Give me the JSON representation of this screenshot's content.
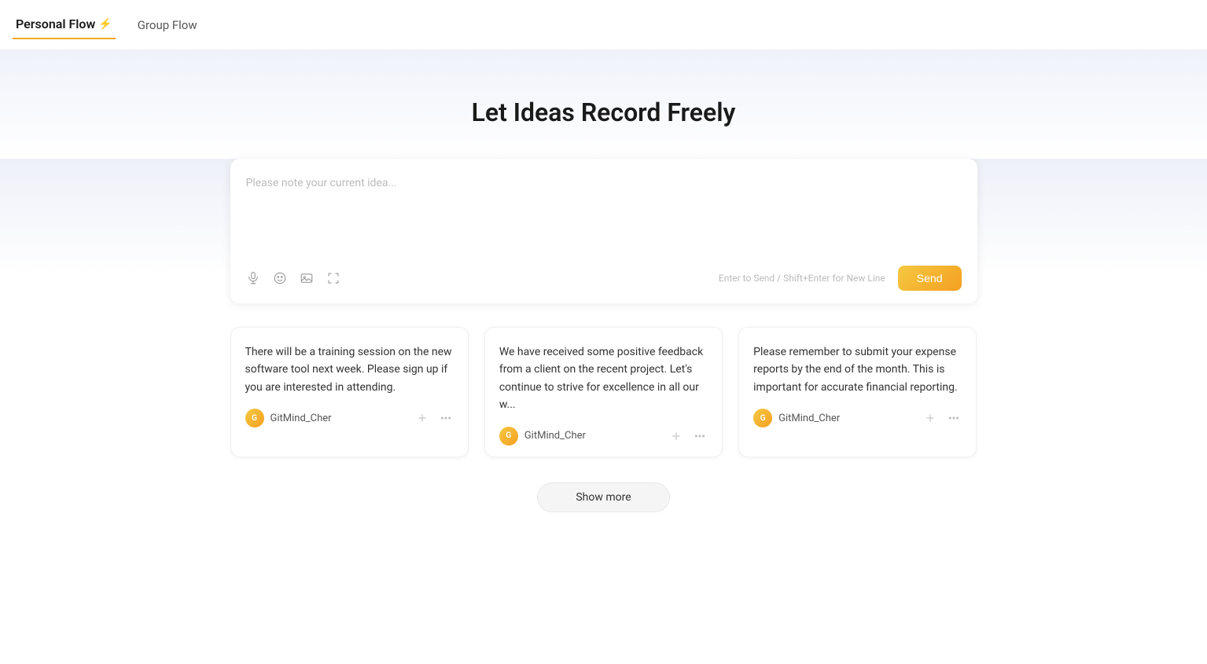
{
  "nav": {
    "personal_flow_label": "Personal Flow",
    "personal_flow_icon": "⚡",
    "group_flow_label": "Group Flow"
  },
  "hero": {
    "title": "Let Ideas Record Freely"
  },
  "input": {
    "placeholder": "Please note your current idea...",
    "hint": "Enter to Send / Shift+Enter for New Line",
    "send_label": "Send",
    "icons": {
      "mic": "mic-icon",
      "emoji": "emoji-icon",
      "image": "image-icon",
      "expand": "expand-icon"
    }
  },
  "cards": [
    {
      "id": 1,
      "text": "There will be a training session on the new software tool next week. Please sign up if you are interested in attending.",
      "author": "GitMind_Cher"
    },
    {
      "id": 2,
      "text": "We have received some positive feedback from a client on the recent project. Let's continue to strive for excellence in all our w...",
      "author": "GitMind_Cher"
    },
    {
      "id": 3,
      "text": "Please remember to submit your expense reports by the end of the month. This is important for accurate financial reporting.",
      "author": "GitMind_Cher"
    }
  ],
  "show_more": {
    "label": "Show more"
  },
  "colors": {
    "accent": "#f5a020",
    "accent_light": "#f5c842",
    "nav_underline": "#f5a623"
  }
}
